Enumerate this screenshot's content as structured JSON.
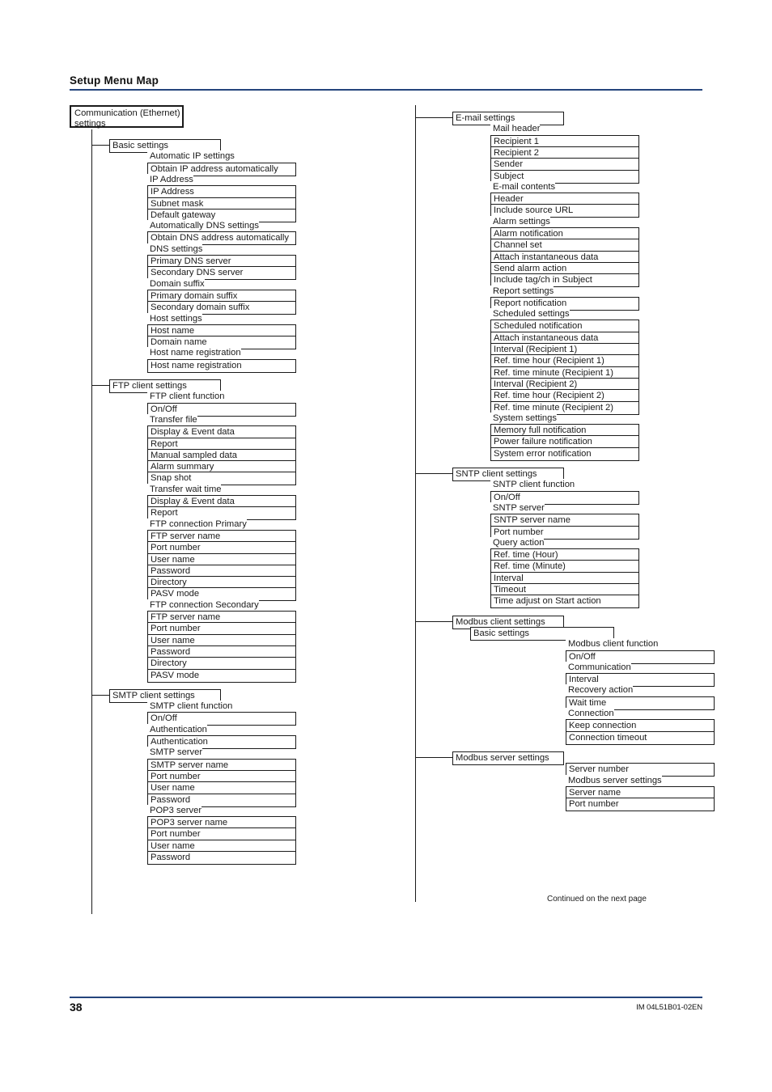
{
  "header": {
    "title": "Setup Menu Map"
  },
  "footer": {
    "page_number": "38",
    "document_code": "IM 04L51B01-02EN",
    "continued_note": "Continued on the next page"
  },
  "tree": {
    "root": "Communication (Ethernet) settings",
    "left_column": [
      {
        "section": "Basic settings",
        "groups": [
          {
            "header": "Automatic IP settings",
            "items": [
              "Obtain IP address automatically"
            ]
          },
          {
            "header": "IP Address",
            "items": [
              "IP Address",
              "Subnet mask",
              "Default gateway"
            ]
          },
          {
            "header": "Automatically DNS settings",
            "items": [
              "Obtain DNS address automatically"
            ]
          },
          {
            "header": "DNS settings",
            "items": [
              "Primary DNS server",
              "Secondary DNS server"
            ]
          },
          {
            "header": "Domain suffix",
            "items": [
              "Primary domain suffix",
              "Secondary domain suffix"
            ]
          },
          {
            "header": "Host settings",
            "items": [
              "Host name",
              "Domain name"
            ]
          },
          {
            "header": "Host name registration",
            "items": [
              "Host name registration"
            ]
          }
        ]
      },
      {
        "section": "FTP client settings",
        "groups": [
          {
            "header": "FTP client function",
            "items": [
              "On/Off"
            ]
          },
          {
            "header": "Transfer file",
            "items": [
              "Display & Event data",
              "Report",
              "Manual sampled data",
              "Alarm summary",
              "Snap shot"
            ]
          },
          {
            "header": "Transfer wait time",
            "items": [
              "Display & Event data",
              "Report"
            ]
          },
          {
            "header": "FTP connection Primary",
            "items": [
              "FTP server name",
              "Port number",
              "User name",
              "Password",
              "Directory",
              "PASV mode"
            ]
          },
          {
            "header": "FTP connection Secondary",
            "items": [
              "FTP server name",
              "Port number",
              "User name",
              "Password",
              "Directory",
              "PASV mode"
            ]
          }
        ]
      },
      {
        "section": "SMTP client settings",
        "groups": [
          {
            "header": "SMTP client function",
            "items": [
              "On/Off"
            ]
          },
          {
            "header": "Authentication",
            "items": [
              "Authentication"
            ]
          },
          {
            "header": "SMTP server",
            "items": [
              "SMTP server name",
              "Port number",
              "User name",
              "Password"
            ]
          },
          {
            "header": "POP3 server",
            "items": [
              "POP3 server name",
              "Port number",
              "User name",
              "Password"
            ]
          }
        ]
      }
    ],
    "right_column": [
      {
        "section": "E-mail settings",
        "groups": [
          {
            "header": "Mail header",
            "items": [
              "Recipient 1",
              "Recipient 2",
              "Sender",
              "Subject"
            ]
          },
          {
            "header": "E-mail contents",
            "items": [
              "Header",
              "Include source URL"
            ]
          },
          {
            "header": "Alarm settings",
            "items": [
              "Alarm notification",
              "Channel set",
              "Attach instantaneous data",
              "Send alarm action",
              "Include tag/ch in Subject"
            ]
          },
          {
            "header": "Report settings",
            "items": [
              "Report notification"
            ]
          },
          {
            "header": "Scheduled settings",
            "items": [
              "Scheduled notification",
              "Attach instantaneous data",
              "Interval (Recipient 1)",
              "Ref. time hour (Recipient 1)",
              "Ref. time minute (Recipient 1)",
              "Interval (Recipient 2)",
              "Ref. time hour (Recipient 2)",
              "Ref. time minute (Recipient 2)"
            ]
          },
          {
            "header": "System settings",
            "items": [
              "Memory full notification",
              "Power failure notification",
              "System error notification"
            ]
          }
        ]
      },
      {
        "section": "SNTP client settings",
        "groups": [
          {
            "header": "SNTP client function",
            "items": [
              "On/Off"
            ]
          },
          {
            "header": "SNTP server",
            "items": [
              "SNTP server name",
              "Port number"
            ]
          },
          {
            "header": "Query action",
            "items": [
              "Ref. time (Hour)",
              "Ref. time (Minute)",
              "Interval",
              "Timeout",
              "Time adjust on Start action"
            ]
          }
        ]
      },
      {
        "section": "Modbus client settings",
        "subsection": "Basic settings",
        "groups": [
          {
            "header": "Modbus client function",
            "items": [
              "On/Off"
            ]
          },
          {
            "header": "Communication",
            "items": [
              "Interval"
            ]
          },
          {
            "header": "Recovery action",
            "items": [
              "Wait time"
            ]
          },
          {
            "header": "Connection",
            "items": [
              "Keep connection",
              "Connection timeout"
            ]
          }
        ]
      },
      {
        "section": "Modbus server settings",
        "groups": [
          {
            "header": "",
            "items": [
              "Server number"
            ]
          },
          {
            "header": "Modbus server settings",
            "items": [
              "Server name",
              "Port number"
            ]
          }
        ]
      }
    ]
  }
}
